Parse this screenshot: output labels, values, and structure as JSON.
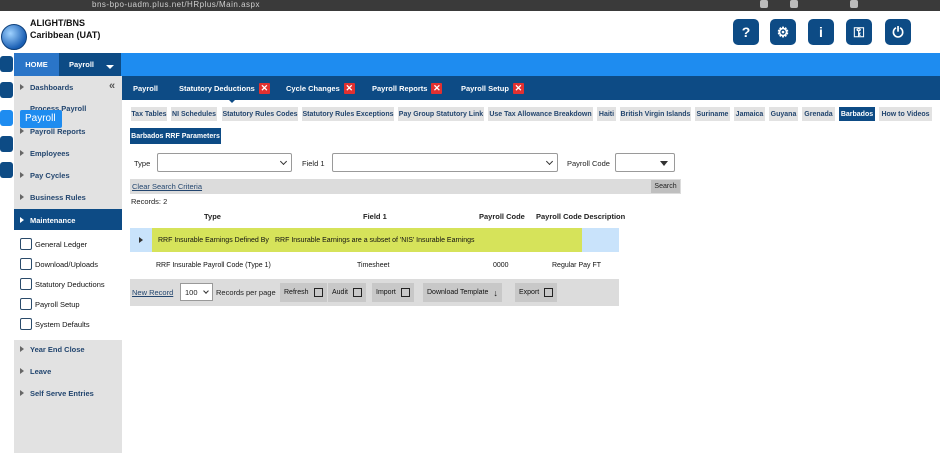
{
  "browser": {
    "url_fragment": "bns-bpo-uadm.plus.net/HRplus/Main.aspx"
  },
  "header": {
    "company_line1": "ALIGHT/BNS",
    "company_line2": "Caribbean (UAT)",
    "buttons": [
      {
        "name": "help-icon",
        "glyph": "?"
      },
      {
        "name": "settings-icon",
        "glyph": "⚙"
      },
      {
        "name": "info-icon",
        "glyph": "i"
      },
      {
        "name": "key-icon",
        "glyph": "⚿"
      },
      {
        "name": "power-icon",
        "glyph": "⏻"
      }
    ]
  },
  "topbar": {
    "home": "HOME",
    "payroll": "Payroll"
  },
  "hover_label": "Payroll",
  "sidebar": {
    "items": [
      {
        "label": "Dashboards"
      },
      {
        "label": "Payroll Reports"
      },
      {
        "label": "Employees"
      },
      {
        "label": "Pay Cycles"
      },
      {
        "label": "Business Rules"
      },
      {
        "label": "Maintenance"
      }
    ],
    "ghost_label": "Process Payroll",
    "maintenance_sub": [
      {
        "label": "General Ledger"
      },
      {
        "label": "Download/Uploads"
      },
      {
        "label": "Statutory Deductions"
      },
      {
        "label": "Payroll Setup"
      },
      {
        "label": "System Defaults"
      }
    ],
    "bottom_items": [
      {
        "label": "Year End Close"
      },
      {
        "label": "Leave"
      },
      {
        "label": "Self Serve Entries"
      }
    ]
  },
  "module_tabs": [
    {
      "label": "Payroll",
      "closable": false
    },
    {
      "label": "Statutory Deductions",
      "closable": true
    },
    {
      "label": "Cycle Changes",
      "closable": true
    },
    {
      "label": "Payroll Reports",
      "closable": true
    },
    {
      "label": "Payroll Setup",
      "closable": true
    }
  ],
  "sub_tabs": [
    {
      "label": "Tax Tables"
    },
    {
      "label": "NI Schedules"
    },
    {
      "label": "Statutory Rules Codes"
    },
    {
      "label": "Statutory Rules Exceptions"
    },
    {
      "label": "Pay Group Statutory Link"
    },
    {
      "label": "Use Tax Allowance Breakdown"
    },
    {
      "label": "Haiti"
    },
    {
      "label": "British Virgin Islands"
    },
    {
      "label": "Suriname"
    },
    {
      "label": "Jamaica"
    },
    {
      "label": "Guyana"
    },
    {
      "label": "Grenada"
    },
    {
      "label": "Barbados",
      "active": true
    },
    {
      "label": "How to Videos"
    }
  ],
  "sub_sub_tab": "Barbados RRF Parameters",
  "filters": {
    "type_label": "Type",
    "field1_label": "Field 1",
    "paycode_label": "Payroll Code",
    "type_value": "",
    "field1_value": "",
    "paycode_value": ""
  },
  "criteria": {
    "clear": "Clear Search Criteria",
    "search": "Search"
  },
  "records": "Records: 2",
  "grid": {
    "columns": [
      "Type",
      "Field 1",
      "Payroll Code",
      "Payroll Code Description"
    ],
    "rows": [
      {
        "type": "RRF Insurable Earnings Defined By",
        "field1": "RRF Insurable Earnings are a subset of 'NIS' Insurable Earnings",
        "code": "",
        "desc": ""
      },
      {
        "type": "RRF Insurable Payroll Code (Type 1)",
        "field1": "Timesheet",
        "code": "0000",
        "desc": "Regular Pay FT"
      }
    ]
  },
  "toolbar": {
    "new_record": "New Record",
    "page_size": "100",
    "records_per_page": "Records per page",
    "refresh": "Refresh",
    "audit": "Audit",
    "import": "Import",
    "download_template": "Download Template",
    "export": "Export"
  },
  "colors": {
    "navy": "#0d4b85",
    "blue": "#1e8cf0",
    "highlight": "#d6e35a",
    "close": "#e23030"
  }
}
